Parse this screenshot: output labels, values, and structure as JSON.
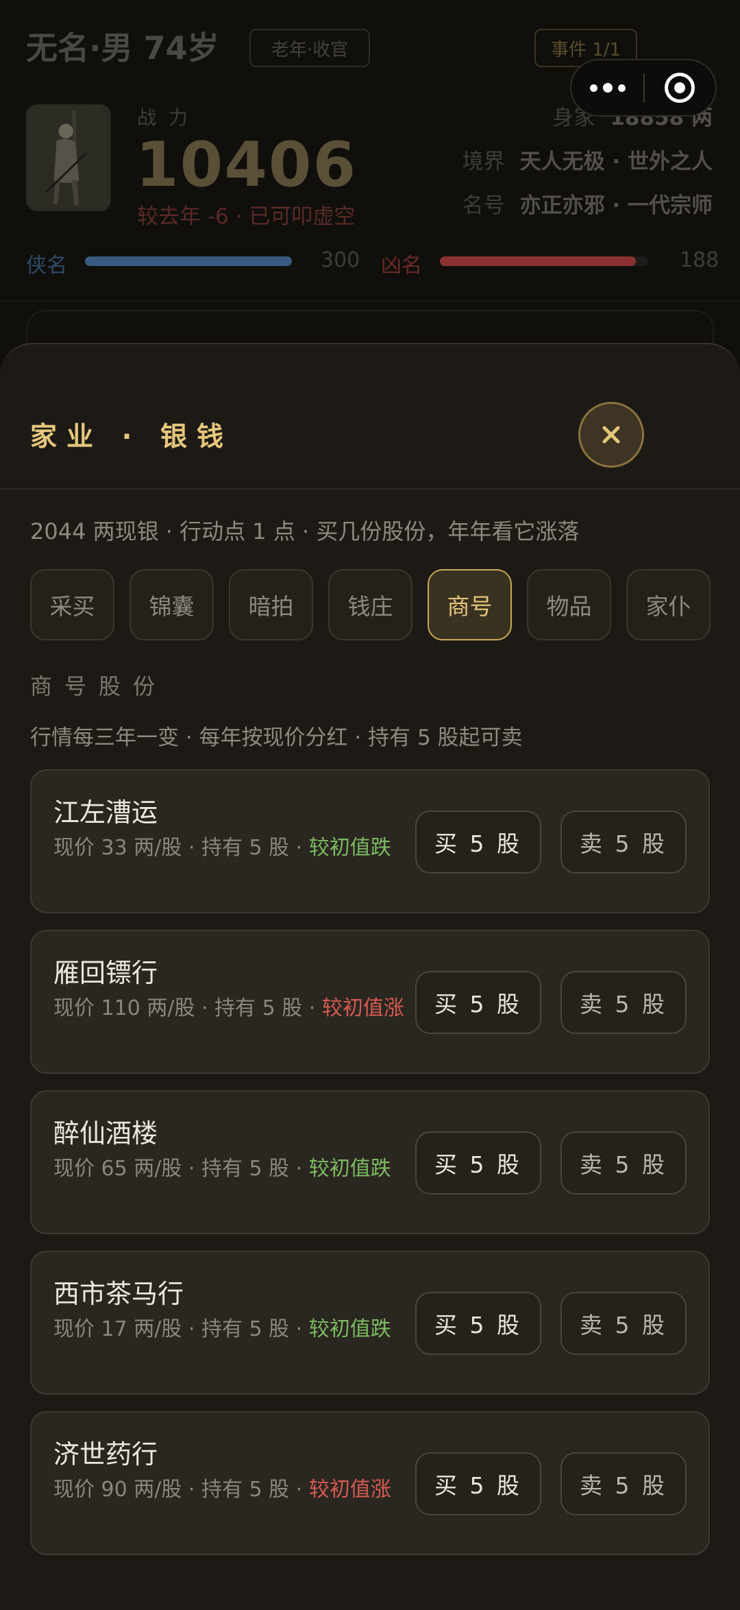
{
  "profile": {
    "name_line": "无名·男 74岁",
    "stage_badge": "老年·收官",
    "event_badge": "事件 1/1",
    "power_label": "战力",
    "power_value": "10406",
    "power_change": "较去年 -6 · 已可叩虚空",
    "wealth": {
      "label": "身家",
      "value": "18858 两"
    },
    "realm": {
      "label": "境界",
      "value": "天人无极 · 世外之人"
    },
    "title": {
      "label": "名号",
      "value": "亦正亦邪 · 一代宗师"
    },
    "chivalry": {
      "label": "侠名",
      "value": "300",
      "fill": 1.0,
      "color": "#3a5a80"
    },
    "infamy": {
      "label": "凶名",
      "value": "188",
      "fill": 0.94,
      "color": "#8a3232"
    }
  },
  "sheet": {
    "title": "家业 · 银钱",
    "summary": "2044 两现银 · 行动点 1 点 · 买几份股份，年年看它涨落",
    "tabs": [
      "采买",
      "锦囊",
      "暗拍",
      "钱庄",
      "商号",
      "物品",
      "家仆"
    ],
    "active_tab": "商号",
    "section_title": "商号股份",
    "section_desc": "行情每三年一变 · 每年按现价分红 · 持有 5 股起可卖",
    "buy_label": "买 5 股",
    "sell_label": "卖 5 股",
    "stocks": [
      {
        "name": "江左漕运",
        "info": "现价 33 两/股 · 持有 5 股 · ",
        "trend": "较初值跌",
        "dir": "down"
      },
      {
        "name": "雁回镖行",
        "info": "现价 110 两/股 · 持有 5 股 · ",
        "trend": "较初值涨",
        "dir": "up"
      },
      {
        "name": "醉仙酒楼",
        "info": "现价 65 两/股 · 持有 5 股 · ",
        "trend": "较初值跌",
        "dir": "down"
      },
      {
        "name": "西市茶马行",
        "info": "现价 17 两/股 · 持有 5 股 · ",
        "trend": "较初值跌",
        "dir": "down"
      },
      {
        "name": "济世药行",
        "info": "现价 90 两/股 · 持有 5 股 · ",
        "trend": "较初值涨",
        "dir": "up"
      }
    ]
  },
  "colors": {
    "accent": "#e5c77d",
    "rise": "#d55b52",
    "fall": "#7dbb62"
  },
  "icons": {
    "close": "close-icon",
    "more": "more-dots-icon",
    "exit": "target-icon"
  }
}
